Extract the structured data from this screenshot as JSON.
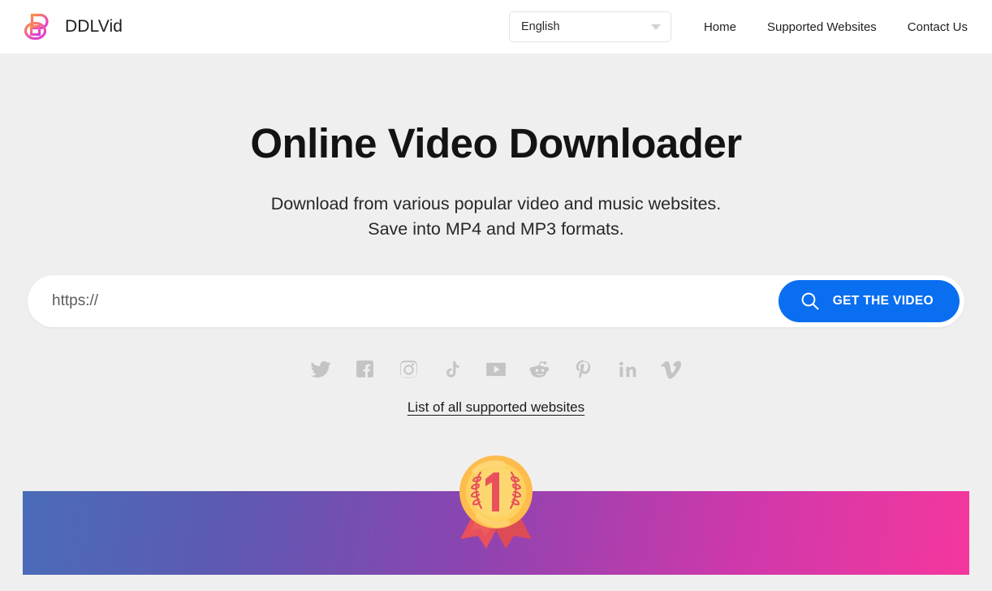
{
  "brand": {
    "name": "DDLVid",
    "logo_icon": "ddlvid-logo-icon"
  },
  "header": {
    "language_select": {
      "selected": "English",
      "icon": "chevron-down-icon",
      "options": [
        "English"
      ]
    },
    "nav": [
      {
        "label": "Home",
        "name": "home"
      },
      {
        "label": "Supported Websites",
        "name": "supported-websites"
      },
      {
        "label": "Contact Us",
        "name": "contact-us"
      }
    ]
  },
  "hero": {
    "title": "Online Video Downloader",
    "subtitle_line1": "Download from various popular video and music websites.",
    "subtitle_line2": "Save into MP4 and MP3 formats."
  },
  "search": {
    "placeholder": "https://",
    "value": "",
    "button_label": "GET THE VIDEO",
    "button_icon": "search-icon",
    "button_color": "#0a6ef0"
  },
  "socials": [
    {
      "name": "twitter",
      "icon": "twitter-icon"
    },
    {
      "name": "facebook",
      "icon": "facebook-icon"
    },
    {
      "name": "instagram",
      "icon": "instagram-icon"
    },
    {
      "name": "tiktok",
      "icon": "tiktok-icon"
    },
    {
      "name": "youtube",
      "icon": "youtube-icon"
    },
    {
      "name": "reddit",
      "icon": "reddit-icon"
    },
    {
      "name": "pinterest",
      "icon": "pinterest-icon"
    },
    {
      "name": "linkedin",
      "icon": "linkedin-icon"
    },
    {
      "name": "vimeo",
      "icon": "vimeo-icon"
    }
  ],
  "supported_link": {
    "label": "List of all supported websites"
  },
  "banner": {
    "badge_icon": "award-ribbon-number-one-icon",
    "badge_number": "1",
    "gradient_start": "#4a6cb8",
    "gradient_end": "#f5379d"
  }
}
